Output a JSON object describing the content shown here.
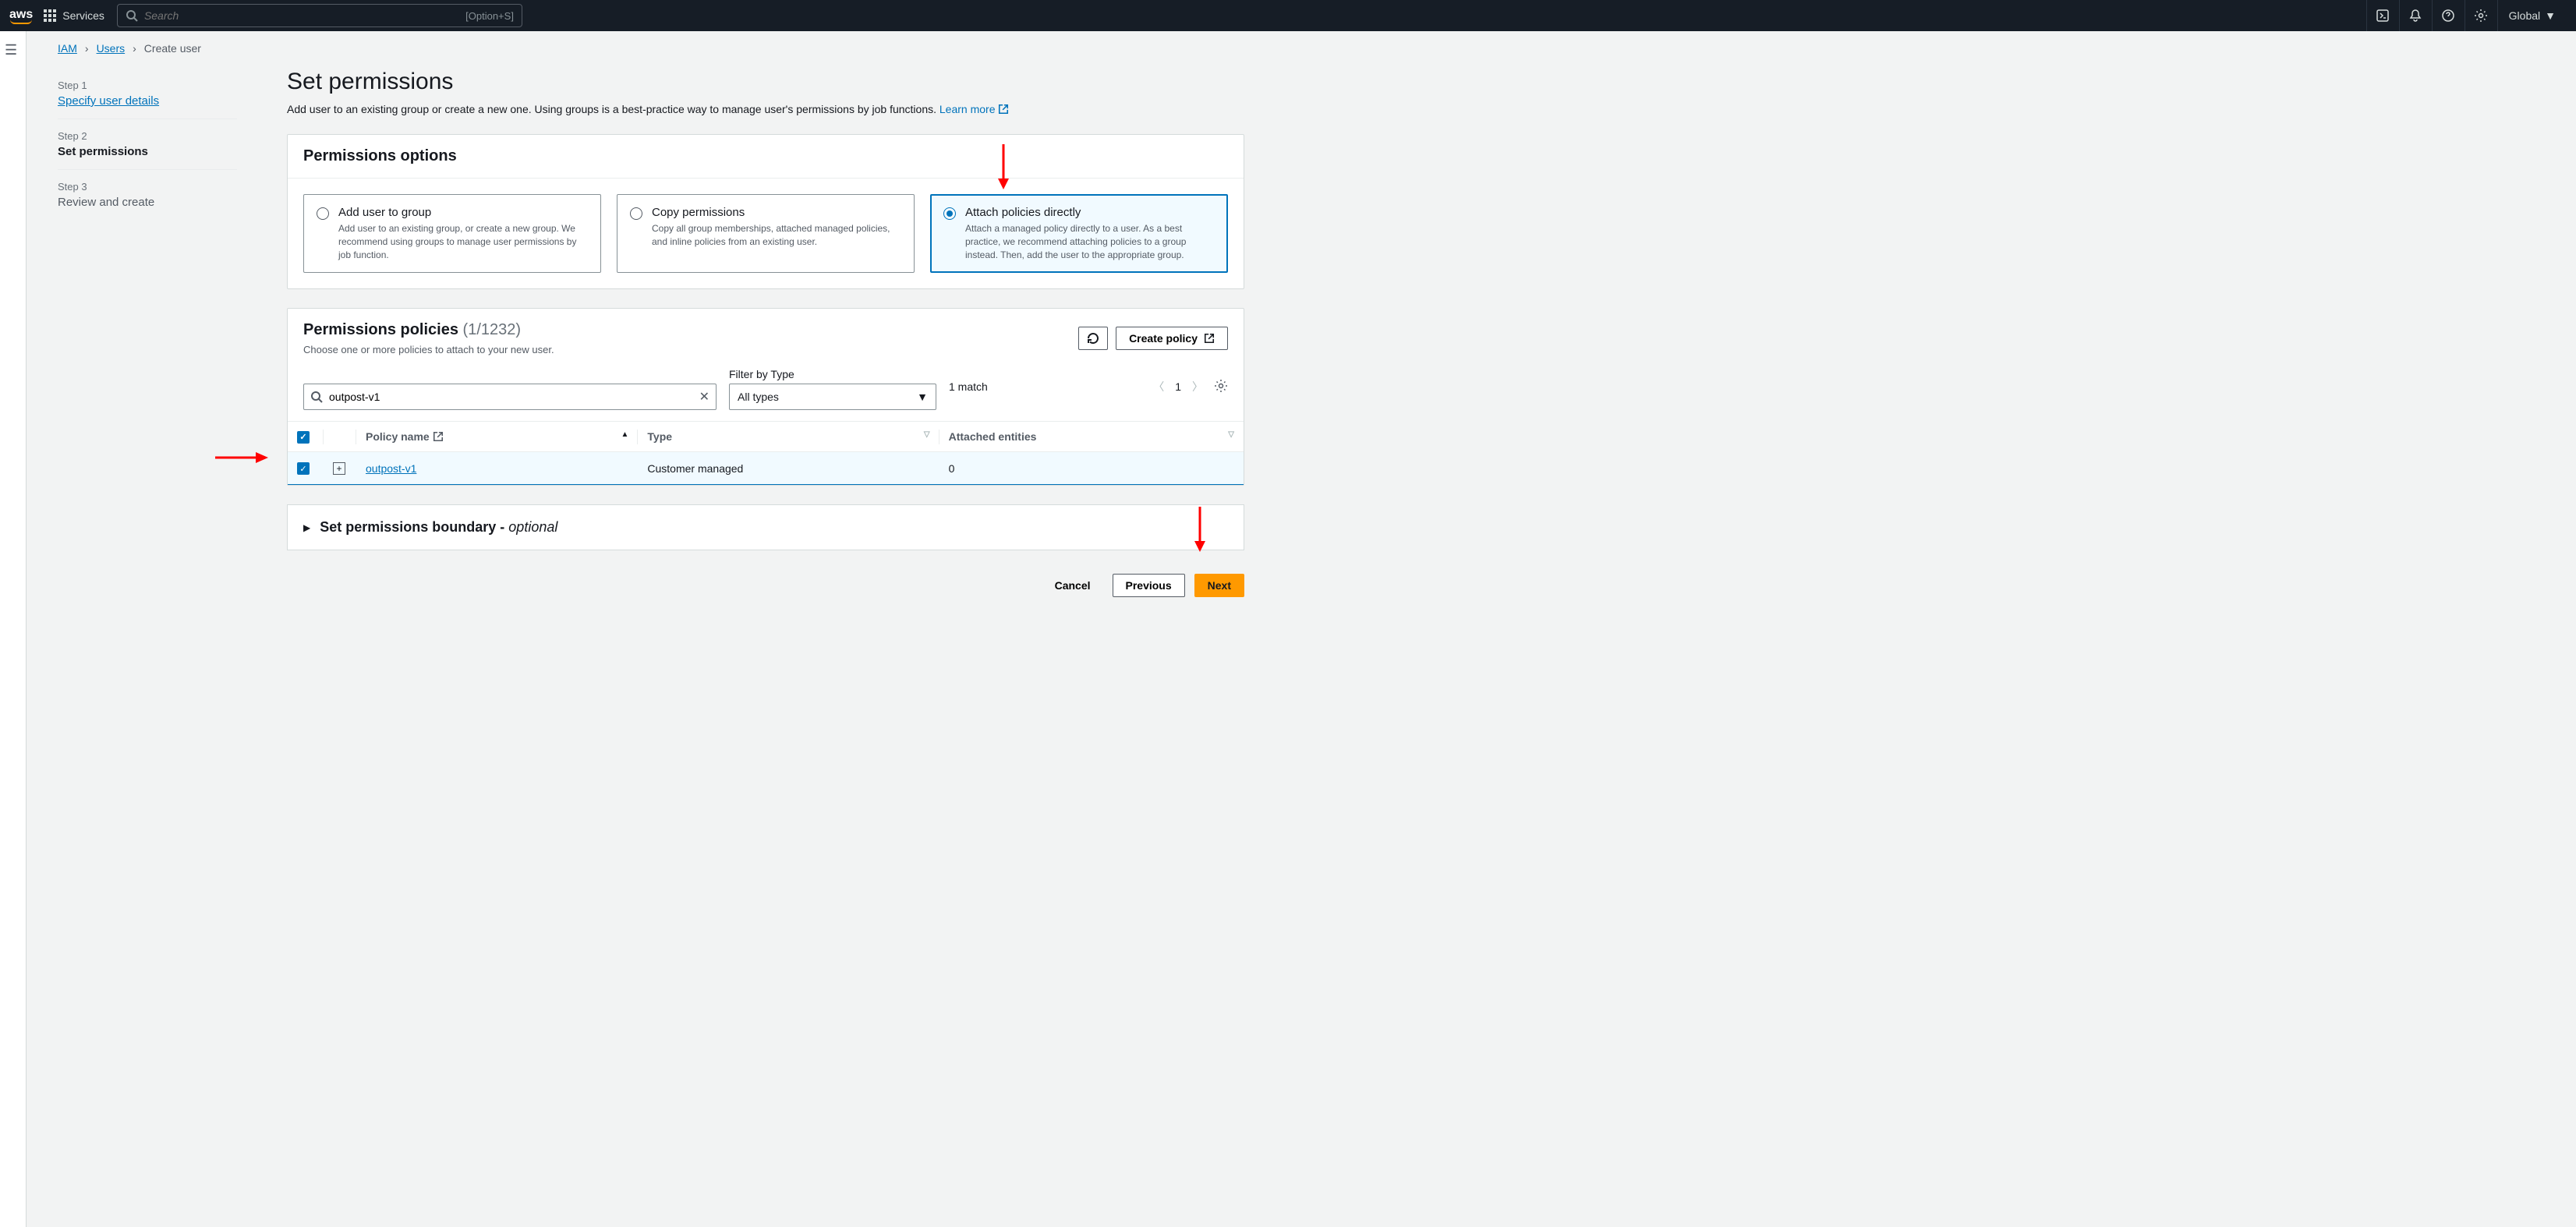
{
  "topnav": {
    "services": "Services",
    "search_placeholder": "Search",
    "search_hint": "[Option+S]",
    "region": "Global"
  },
  "breadcrumb": {
    "iam": "IAM",
    "users": "Users",
    "create": "Create user"
  },
  "steps": {
    "s1_label": "Step 1",
    "s1_title": "Specify user details",
    "s2_label": "Step 2",
    "s2_title": "Set permissions",
    "s3_label": "Step 3",
    "s3_title": "Review and create"
  },
  "heading": "Set permissions",
  "subtitle": "Add user to an existing group or create a new one. Using groups is a best-practice way to manage user's permissions by job functions. ",
  "learn_more": "Learn more",
  "perm_options": {
    "title": "Permissions options",
    "opt1_title": "Add user to group",
    "opt1_desc": "Add user to an existing group, or create a new group. We recommend using groups to manage user permissions by job function.",
    "opt2_title": "Copy permissions",
    "opt2_desc": "Copy all group memberships, attached managed policies, and inline policies from an existing user.",
    "opt3_title": "Attach policies directly",
    "opt3_desc": "Attach a managed policy directly to a user. As a best practice, we recommend attaching policies to a group instead. Then, add the user to the appropriate group."
  },
  "policies": {
    "title": "Permissions policies",
    "count": "(1/1232)",
    "hint": "Choose one or more policies to attach to your new user.",
    "refresh": "Refresh",
    "create": "Create policy",
    "filter_label": "Filter by Type",
    "search_value": "outpost-v1",
    "type_value": "All types",
    "matches": "1 match",
    "page": "1",
    "cols": {
      "name": "Policy name",
      "type": "Type",
      "entities": "Attached entities"
    },
    "row": {
      "name": "outpost-v1",
      "type": "Customer managed",
      "entities": "0"
    }
  },
  "boundary": {
    "title": "Set permissions boundary - ",
    "optional": "optional"
  },
  "footer": {
    "cancel": "Cancel",
    "previous": "Previous",
    "next": "Next"
  }
}
